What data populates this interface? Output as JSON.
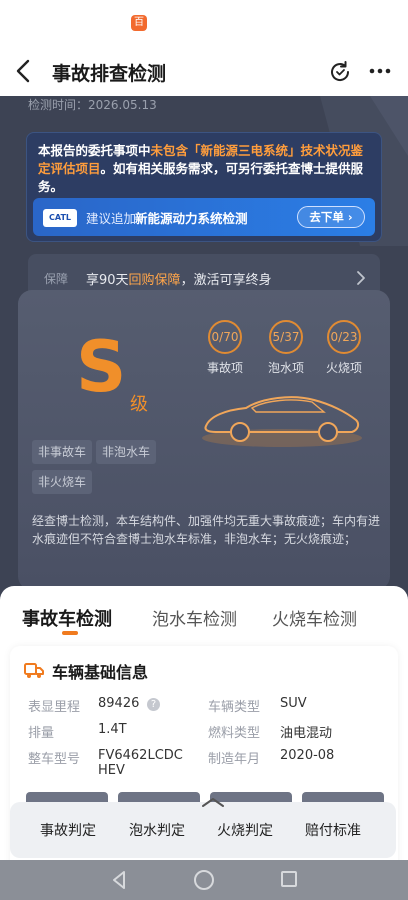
{
  "statusbar": {
    "app_icon": "app-notification-icon",
    "app_icon_glyph": "百"
  },
  "navbar": {
    "title": "事故排查检测",
    "back_icon": "chevron-left-icon",
    "refresh_icon": "refresh-icon",
    "more_icon": "more-icon"
  },
  "report": {
    "detect_time": "检测时间：2026.05.13"
  },
  "notice": {
    "part1": "本报告的委托事项中",
    "highlight": "未包含「新能源三电系统」技术状况鉴定评估项目",
    "part2": "。如有相关服务需求，可另行委托查博士提供服务。",
    "suggest_logo": "CATL",
    "suggest_prefix": "建议追加",
    "suggest_item": "新能源动力系统检测",
    "order_button": "去下单"
  },
  "guarantee": {
    "tag": "保障",
    "text_before": "享90天",
    "text_highlight": "回购保障",
    "text_after": "，激活可享终身"
  },
  "grade": {
    "letter": "S",
    "suffix": "级",
    "stats": [
      {
        "value": "0/70",
        "label": "事故项"
      },
      {
        "value": "5/37",
        "label": "泡水项"
      },
      {
        "value": "0/23",
        "label": "火烧项"
      }
    ],
    "chips": [
      "非事故车",
      "非泡水车",
      "非火烧车"
    ],
    "summary": "经查博士检测，本车结构件、加强件均无重大事故痕迹；车内有进水痕迹但不符合查博士泡水车标准，非泡水车；无火烧痕迹；"
  },
  "tabs": [
    "事故车检测",
    "泡水车检测",
    "火烧车检测"
  ],
  "vehicle_info": {
    "title": "车辆基础信息",
    "icon": "truck-icon",
    "rows": [
      {
        "k1": "表显里程",
        "v1": "89426",
        "k2": "车辆类型",
        "v2": "SUV"
      },
      {
        "k1": "排量",
        "v1": "1.4T",
        "k2": "燃料类型",
        "v2": "油电混动"
      },
      {
        "k1": "整车型号",
        "v1": "FV6462LCDC HEV",
        "k2": "制造年月",
        "v2": "2020-08"
      }
    ]
  },
  "bottom_bar": [
    "事故判定",
    "泡水判定",
    "火烧判定",
    "赔付标准"
  ],
  "colors": {
    "accent": "#f07b1f",
    "grade": "#f08f2a",
    "dark_bg": "#3d4354",
    "suggest_blue": "#2b7ee6"
  }
}
